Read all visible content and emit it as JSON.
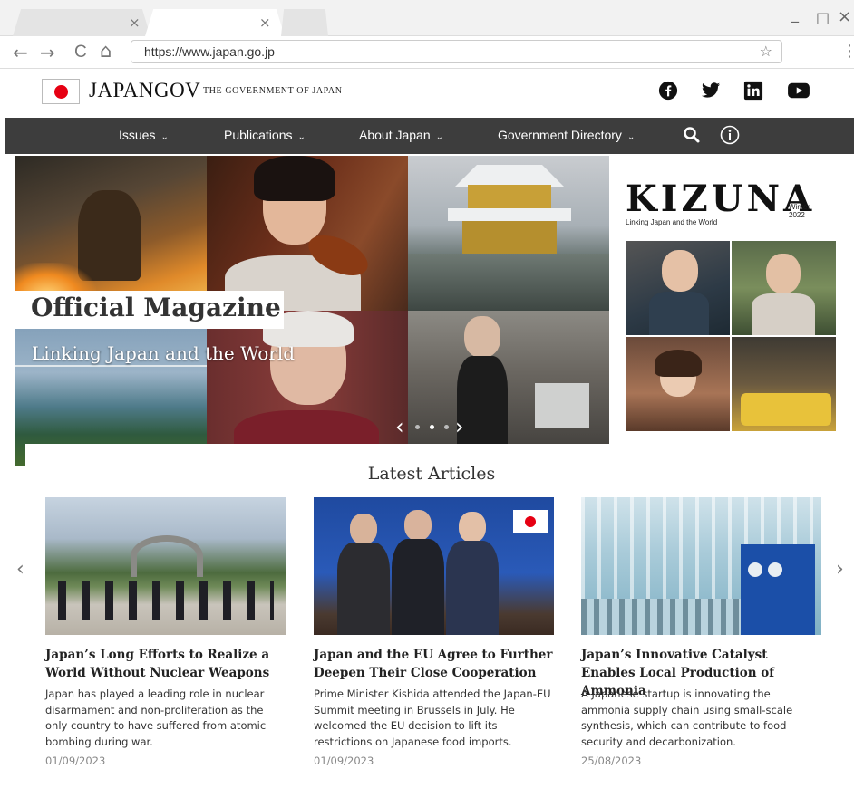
{
  "browser": {
    "tabs": [
      {
        "close_glyph": "×"
      },
      {
        "close_glyph": "×"
      }
    ],
    "window_controls": {
      "minimize": "_",
      "maximize": "□",
      "close": "×"
    },
    "url": "https://www.japan.go.jp",
    "nav": {
      "back": "←",
      "forward": "→",
      "reload": "C",
      "home": "⌂"
    },
    "bookmark_glyph": "☆",
    "menu_glyph": "⋮"
  },
  "header": {
    "brand": "JAPANGOV",
    "subtitle": "The Government of Japan",
    "social": [
      "facebook-icon",
      "twitter-icon",
      "linkedin-icon",
      "youtube-icon"
    ]
  },
  "nav": {
    "items": [
      {
        "label": "Issues"
      },
      {
        "label": "Publications"
      },
      {
        "label": "About Japan"
      },
      {
        "label": "Government Directory"
      }
    ],
    "icons": [
      "search-icon",
      "info-icon"
    ]
  },
  "hero": {
    "title": "Official Magazine",
    "subtitle": "Linking Japan and the World",
    "kizuna": {
      "word": "KIZUNA",
      "tagline": "Linking Japan and the World",
      "season": "Winter",
      "year": "2022"
    },
    "carousel": {
      "prev": "‹",
      "next": "›",
      "slides": 3,
      "current": 2
    }
  },
  "latest": {
    "title": "Latest Articles",
    "prev": "‹",
    "next": "›",
    "articles": [
      {
        "title": "Japan’s Long Efforts to Realize a World Without Nuclear Weapons",
        "desc": "Japan has played a leading role in nuclear disarmament and non-proliferation as the only country to have suffered from atomic bombing during war.",
        "date": "01/09/2023"
      },
      {
        "title": "Japan and the EU Agree to Further Deepen Their Close Cooperation",
        "desc": "Prime Minister Kishida attended the Japan-EU Summit meeting in Brussels in July. He welcomed the EU decision to lift its restrictions on Japanese food imports.",
        "date": "01/09/2023"
      },
      {
        "title": "Japan’s Innovative Catalyst Enables Local Production of Ammonia",
        "desc": "A Japanese startup is innovating the ammonia supply chain using small-scale synthesis, which can contribute to food security and decarbonization.",
        "date": "25/08/2023"
      }
    ]
  },
  "colors": {
    "nav_bg": "#3d3d3d",
    "flag_red": "#e60012",
    "date_gray": "#888888"
  }
}
